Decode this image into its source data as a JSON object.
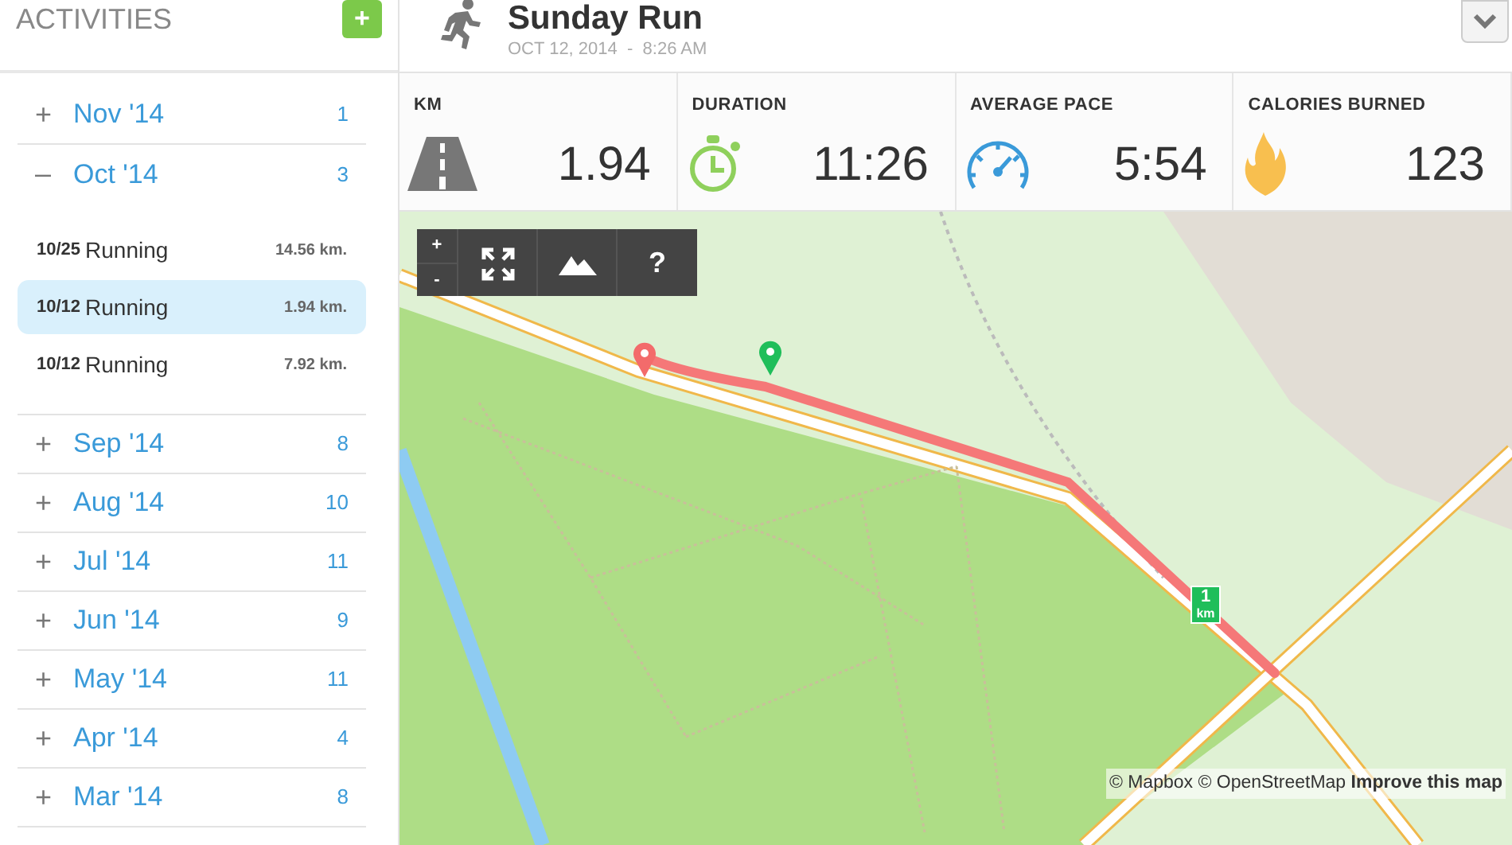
{
  "sidebar": {
    "title": "ACTIVITIES",
    "add_button": "+",
    "months": [
      {
        "toggle": "+",
        "label": "Nov '14",
        "count": "1",
        "expanded": false
      },
      {
        "toggle": "–",
        "label": "Oct '14",
        "count": "3",
        "expanded": true,
        "activities": [
          {
            "date": "10/25",
            "type": "Running",
            "distance": "14.56 km.",
            "selected": false
          },
          {
            "date": "10/12",
            "type": "Running",
            "distance": "1.94 km.",
            "selected": true
          },
          {
            "date": "10/12",
            "type": "Running",
            "distance": "7.92 km.",
            "selected": false
          }
        ]
      },
      {
        "toggle": "+",
        "label": "Sep '14",
        "count": "8",
        "expanded": false
      },
      {
        "toggle": "+",
        "label": "Aug '14",
        "count": "10",
        "expanded": false
      },
      {
        "toggle": "+",
        "label": "Jul '14",
        "count": "11",
        "expanded": false
      },
      {
        "toggle": "+",
        "label": "Jun '14",
        "count": "9",
        "expanded": false
      },
      {
        "toggle": "+",
        "label": "May '14",
        "count": "11",
        "expanded": false
      },
      {
        "toggle": "+",
        "label": "Apr '14",
        "count": "4",
        "expanded": false
      },
      {
        "toggle": "+",
        "label": "Mar '14",
        "count": "8",
        "expanded": false
      }
    ]
  },
  "header": {
    "title": "Sunday Run",
    "date": "OCT 12, 2014",
    "separator": "-",
    "time": "8:26 AM"
  },
  "stats": [
    {
      "kind": "road",
      "label": "KM",
      "value": "1.94"
    },
    {
      "kind": "stopwatch",
      "label": "DURATION",
      "value": "11:26"
    },
    {
      "kind": "gauge",
      "label": "AVERAGE PACE",
      "value": "5:54"
    },
    {
      "kind": "flame",
      "label": "CALORIES BURNED",
      "value": "123"
    }
  ],
  "map": {
    "zoom_in": "+",
    "zoom_out": "-",
    "help": "?",
    "km_marker": {
      "number": "1",
      "unit": "km"
    },
    "attribution": "© Mapbox © OpenStreetMap",
    "improve_link": "Improve this map"
  }
}
